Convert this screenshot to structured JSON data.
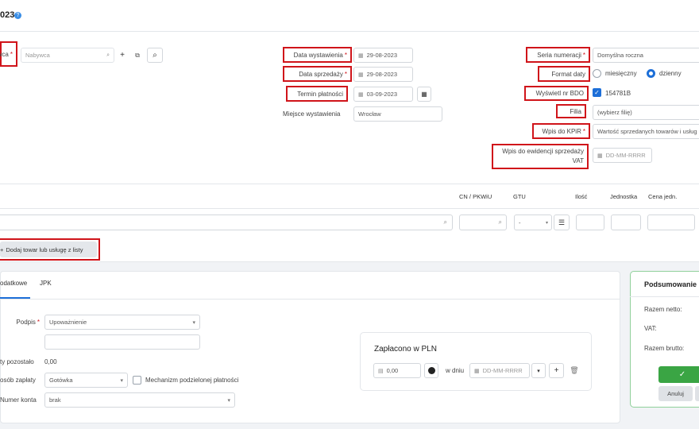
{
  "header": {
    "title": "023"
  },
  "top_form": {
    "buyer_label": "wca",
    "buyer_placeholder": "Nabywca",
    "issue_date_label": "Data wystawienia",
    "issue_date_value": "29-08-2023",
    "sale_date_label": "Data sprzedaży",
    "sale_date_value": "29-08-2023",
    "payment_term_label": "Termin płatności",
    "payment_term_value": "03-09-2023",
    "place_label": "Miejsce wystawienia",
    "place_value": "Wrocław",
    "numbering_label": "Seria numeracji",
    "numbering_value": "Domyślna roczna",
    "date_format_label": "Format daty",
    "date_format_options": [
      "miesięczny",
      "dzienny"
    ],
    "date_format_selected": "dzienny",
    "bdo_label": "Wyświetl nr BDO",
    "bdo_value": "154781B",
    "branch_label": "Filia",
    "branch_value": "(wybierz filię)",
    "kpir_label": "Wpis do KPiR",
    "kpir_value": "Wartość sprzedanych towarów i usług",
    "vat_register_label_1": "Wpis do ewidencji sprzedaży",
    "vat_register_label_2": "VAT",
    "vat_register_placeholder": "DD-MM-RRRR",
    "required_mark": "*"
  },
  "items_table": {
    "columns": [
      "CN / PKWiU",
      "GTU",
      "Ilość",
      "Jednostka",
      "Cena jedn."
    ],
    "gtu_value": "-",
    "add_from_list_label": "Dodaj towar lub usługę z listy"
  },
  "bottom": {
    "tabs": [
      "odatkowe",
      "JPK"
    ],
    "signature_label": "Podpis",
    "signature_value": "Upoważnienie",
    "remaining_label": "ty pozostało",
    "remaining_value": "0,00",
    "payment_method_label": "osób zapłaty",
    "payment_method_value": "Gotówka",
    "split_payment_label": "Mechanizm podzielonej płatności",
    "account_label": "Numer konta",
    "account_value": "brak"
  },
  "paid": {
    "title": "Zapłacono w PLN",
    "amount": "0,00",
    "on_day_label": "w dniu",
    "date_placeholder": "DD-MM-RRRR"
  },
  "summary": {
    "title": "Podsumowanie",
    "net_label": "Razem netto:",
    "vat_label": "VAT:",
    "gross_label": "Razem brutto:",
    "confirm_icon": "✓",
    "cancel_label": "Anuluj"
  },
  "colors": {
    "highlight": "#d0141a",
    "accent": "#1d6fd8",
    "success": "#3aa544"
  }
}
